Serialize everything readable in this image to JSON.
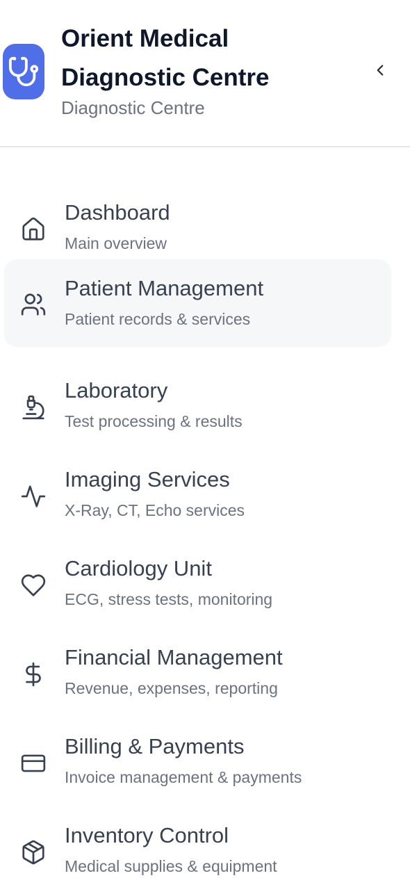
{
  "header": {
    "title": "Orient Medical Diagnostic Centre",
    "subtitle": "Diagnostic Centre",
    "logo_icon": "stethoscope-icon",
    "collapse_icon": "chevron-left-icon",
    "brand_color": "#4f6ee8"
  },
  "nav": {
    "items": [
      {
        "label": "Dashboard",
        "desc": "Main overview",
        "icon": "home-icon"
      },
      {
        "label": "Patient Management",
        "desc": "Patient records & services",
        "icon": "users-icon",
        "active": true
      },
      {
        "label": "Laboratory",
        "desc": "Test processing & results",
        "icon": "microscope-icon"
      },
      {
        "label": "Imaging Services",
        "desc": "X-Ray, CT, Echo services",
        "icon": "activity-icon"
      },
      {
        "label": "Cardiology Unit",
        "desc": "ECG, stress tests, monitoring",
        "icon": "heart-icon"
      },
      {
        "label": "Financial Management",
        "desc": "Revenue, expenses, reporting",
        "icon": "dollar-icon"
      },
      {
        "label": "Billing & Payments",
        "desc": "Invoice management & payments",
        "icon": "credit-card-icon"
      },
      {
        "label": "Inventory Control",
        "desc": "Medical supplies & equipment",
        "icon": "package-icon"
      }
    ]
  }
}
